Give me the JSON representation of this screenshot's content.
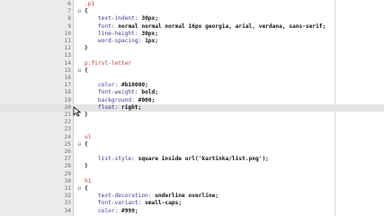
{
  "lines": [
    {
      "num": "6",
      "fold": "",
      "parts": [
        {
          "t": "sel",
          "v": ".p1"
        }
      ]
    },
    {
      "num": "7",
      "fold": "⊟",
      "parts": [
        {
          "t": "brace",
          "v": "{"
        }
      ]
    },
    {
      "num": "8",
      "fold": "",
      "parts": [
        {
          "t": "prop",
          "v": "    text-indent: "
        },
        {
          "t": "val",
          "v": "30px"
        },
        {
          "t": "brace",
          "v": ";"
        }
      ]
    },
    {
      "num": "9",
      "fold": "",
      "parts": [
        {
          "t": "prop",
          "v": "    font: "
        },
        {
          "t": "val",
          "v": "normal normal normal 16px georgia, arial, verdana, sans-serif"
        },
        {
          "t": "brace",
          "v": ";"
        }
      ]
    },
    {
      "num": "10",
      "fold": "",
      "parts": [
        {
          "t": "prop",
          "v": "    line-height: "
        },
        {
          "t": "val",
          "v": "30px"
        },
        {
          "t": "brace",
          "v": ";"
        }
      ]
    },
    {
      "num": "11",
      "fold": "",
      "parts": [
        {
          "t": "prop",
          "v": "    word-spacing: "
        },
        {
          "t": "val",
          "v": "1px"
        },
        {
          "t": "brace",
          "v": ";"
        }
      ]
    },
    {
      "num": "12",
      "fold": "",
      "parts": [
        {
          "t": "brace",
          "v": "}"
        }
      ]
    },
    {
      "num": "13",
      "fold": "",
      "parts": []
    },
    {
      "num": "14",
      "fold": "",
      "parts": [
        {
          "t": "sel",
          "v": "p:first-letter"
        }
      ]
    },
    {
      "num": "15",
      "fold": "⊟",
      "parts": [
        {
          "t": "brace",
          "v": "{"
        }
      ]
    },
    {
      "num": "16",
      "fold": "",
      "parts": []
    },
    {
      "num": "17",
      "fold": "",
      "parts": [
        {
          "t": "prop",
          "v": "    color: "
        },
        {
          "t": "val",
          "v": "#b10000"
        },
        {
          "t": "brace",
          "v": ";"
        }
      ]
    },
    {
      "num": "18",
      "fold": "",
      "parts": [
        {
          "t": "prop",
          "v": "    font-weight: "
        },
        {
          "t": "val",
          "v": "bold"
        },
        {
          "t": "brace",
          "v": ";"
        }
      ]
    },
    {
      "num": "19",
      "fold": "",
      "parts": [
        {
          "t": "prop",
          "v": "    background: "
        },
        {
          "t": "val",
          "v": "#000"
        },
        {
          "t": "brace",
          "v": ";"
        }
      ]
    },
    {
      "num": "20",
      "fold": "",
      "current": true,
      "parts": [
        {
          "t": "prop",
          "v": "    float: "
        },
        {
          "t": "val",
          "v": "right"
        },
        {
          "t": "brace",
          "v": ";"
        }
      ]
    },
    {
      "num": "21",
      "fold": "",
      "parts": [
        {
          "t": "brace",
          "v": "}"
        }
      ]
    },
    {
      "num": "22",
      "fold": "",
      "parts": []
    },
    {
      "num": "23",
      "fold": "",
      "parts": []
    },
    {
      "num": "24",
      "fold": "",
      "parts": [
        {
          "t": "sel",
          "v": "ul"
        }
      ]
    },
    {
      "num": "25",
      "fold": "⊟",
      "parts": [
        {
          "t": "brace",
          "v": "{"
        }
      ]
    },
    {
      "num": "26",
      "fold": "",
      "parts": []
    },
    {
      "num": "27",
      "fold": "",
      "parts": [
        {
          "t": "prop",
          "v": "    list-style: "
        },
        {
          "t": "val",
          "v": "square inside url('kartinka/list.png')"
        },
        {
          "t": "brace",
          "v": ";"
        }
      ]
    },
    {
      "num": "28",
      "fold": "",
      "parts": [
        {
          "t": "brace",
          "v": "}"
        }
      ]
    },
    {
      "num": "29",
      "fold": "",
      "parts": []
    },
    {
      "num": "30",
      "fold": "",
      "parts": [
        {
          "t": "sel",
          "v": "h1"
        }
      ]
    },
    {
      "num": "31",
      "fold": "⊟",
      "parts": [
        {
          "t": "brace",
          "v": "{"
        }
      ]
    },
    {
      "num": "32",
      "fold": "",
      "parts": [
        {
          "t": "prop",
          "v": "    text-decoration: "
        },
        {
          "t": "val",
          "v": "underline overline"
        },
        {
          "t": "brace",
          "v": ";"
        }
      ]
    },
    {
      "num": "33",
      "fold": "",
      "parts": [
        {
          "t": "prop",
          "v": "    font-variant: "
        },
        {
          "t": "val",
          "v": "small-caps"
        },
        {
          "t": "brace",
          "v": ";"
        }
      ]
    },
    {
      "num": "34",
      "fold": "",
      "parts": [
        {
          "t": "prop",
          "v": "    color: "
        },
        {
          "t": "val",
          "v": "#999"
        },
        {
          "t": "brace",
          "v": ";"
        }
      ]
    }
  ]
}
